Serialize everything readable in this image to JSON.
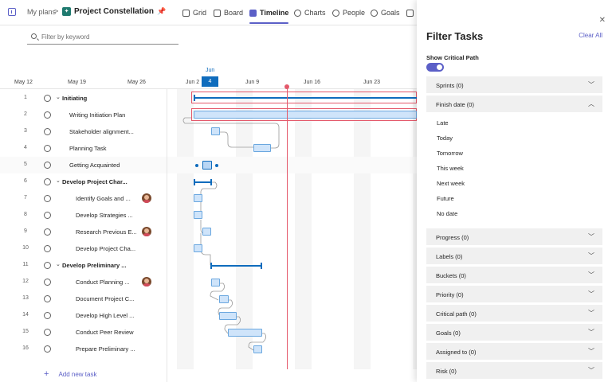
{
  "topbar": {
    "crumb": "My plans",
    "crumb_sep": ">",
    "project_title": "Project Constellation",
    "tabs": [
      {
        "label": "Grid",
        "active": false
      },
      {
        "label": "Board",
        "active": false
      },
      {
        "label": "Timeline",
        "active": true
      },
      {
        "label": "Charts",
        "active": false
      },
      {
        "label": "People",
        "active": false
      },
      {
        "label": "Goals",
        "active": false
      }
    ]
  },
  "search": {
    "placeholder": "Filter by keyword",
    "value": ""
  },
  "timeline": {
    "month": "Jun",
    "today": "4",
    "dates": [
      "May 12",
      "May 19",
      "May 26",
      "Jun 2",
      "Jun 9",
      "Jun 16",
      "Jun 23"
    ]
  },
  "tasks": [
    {
      "num": "1",
      "title": "Initiating",
      "group": true
    },
    {
      "num": "2",
      "title": "Writing Initiation Plan"
    },
    {
      "num": "3",
      "title": "Stakeholder alignment..."
    },
    {
      "num": "4",
      "title": "Planning Task"
    },
    {
      "num": "5",
      "title": "Getting Acquainted"
    },
    {
      "num": "6",
      "title": "Develop Project Char...",
      "group": true
    },
    {
      "num": "7",
      "title": "Identify Goals and ...",
      "avatar": true
    },
    {
      "num": "8",
      "title": "Develop Strategies ..."
    },
    {
      "num": "9",
      "title": "Research Previous E...",
      "avatar": true
    },
    {
      "num": "10",
      "title": "Develop Project Cha..."
    },
    {
      "num": "11",
      "title": "Develop Preliminary ...",
      "group": true
    },
    {
      "num": "12",
      "title": "Conduct Planning ...",
      "avatar": true
    },
    {
      "num": "13",
      "title": "Document Project C..."
    },
    {
      "num": "14",
      "title": "Develop High Level ..."
    },
    {
      "num": "15",
      "title": "Conduct Peer Review"
    },
    {
      "num": "16",
      "title": "Prepare Preliminary ..."
    }
  ],
  "add_task_label": "Add new task",
  "filter_panel": {
    "title": "Filter Tasks",
    "clear_all": "Clear All",
    "critical_path_label": "Show Critical Path",
    "critical_path_on": true,
    "sections": [
      {
        "label": "Sprints (0)",
        "expanded": false
      },
      {
        "label": "Finish date (0)",
        "expanded": true
      },
      {
        "label": "Progress (0)",
        "expanded": false
      },
      {
        "label": "Labels (0)",
        "expanded": false
      },
      {
        "label": "Buckets (0)",
        "expanded": false
      },
      {
        "label": "Priority (0)",
        "expanded": false
      },
      {
        "label": "Critical path (0)",
        "expanded": false
      },
      {
        "label": "Goals (0)",
        "expanded": false
      },
      {
        "label": "Assigned to (0)",
        "expanded": false
      },
      {
        "label": "Risk (0)",
        "expanded": false
      }
    ],
    "finish_date_options": [
      "Late",
      "Today",
      "Tomorrow",
      "This week",
      "Next week",
      "Future",
      "No date"
    ]
  },
  "colors": {
    "accent": "#5b5fc7",
    "today": "#0f6cbd",
    "critical": "#e4586a",
    "bar_fill": "#cfe4fa"
  }
}
